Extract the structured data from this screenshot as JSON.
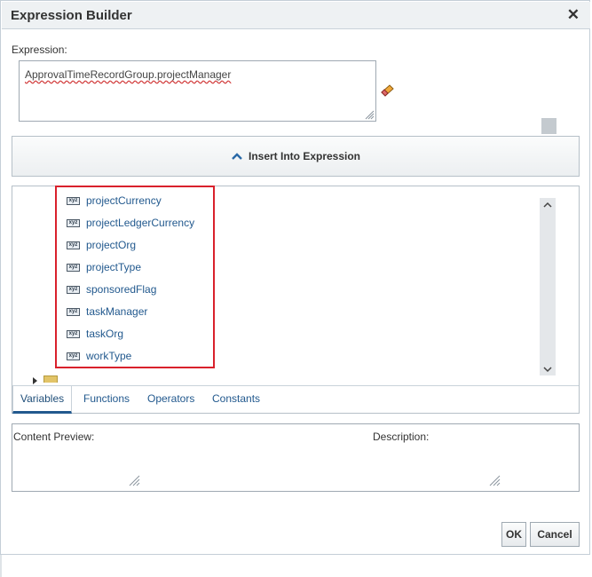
{
  "dialog": {
    "title": "Expression Builder",
    "close_icon": "close-icon"
  },
  "expression": {
    "label": "Expression:",
    "value": "ApprovalTimeRecordGroup.projectManager",
    "clear_icon": "eraser-icon"
  },
  "insert_button": {
    "label": "Insert Into Expression",
    "icon": "chevron-up-icon"
  },
  "tree": {
    "item_icon": "variable-xyz-icon",
    "icon_text": "xyz",
    "items": [
      {
        "label": "projectCurrency"
      },
      {
        "label": "projectLedgerCurrency"
      },
      {
        "label": "projectOrg"
      },
      {
        "label": "projectType"
      },
      {
        "label": "sponsoredFlag"
      },
      {
        "label": "taskManager"
      },
      {
        "label": "taskOrg"
      },
      {
        "label": "workType"
      }
    ]
  },
  "tabs": [
    {
      "label": "Variables",
      "active": true
    },
    {
      "label": "Functions",
      "active": false
    },
    {
      "label": "Operators",
      "active": false
    },
    {
      "label": "Constants",
      "active": false
    }
  ],
  "preview": {
    "content_label": "Content Preview:",
    "description_label": "Description:"
  },
  "footer": {
    "ok_label": "OK",
    "cancel_label": "Cancel"
  },
  "colors": {
    "link": "#22598e",
    "highlight": "#d9212c",
    "titlebar": "#eef1f3"
  }
}
